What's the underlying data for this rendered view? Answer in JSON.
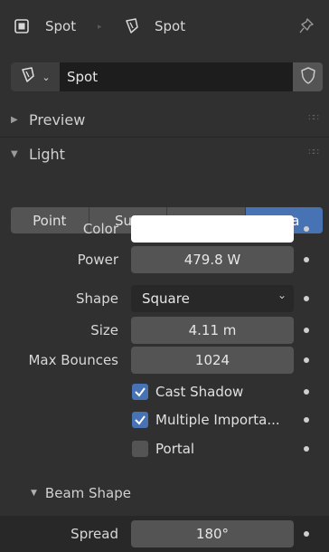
{
  "header": {
    "object_name": "Spot",
    "data_name": "Spot"
  },
  "datablock": {
    "name": "Spot"
  },
  "panels": {
    "preview": "Preview",
    "light": "Light",
    "beam_shape": "Beam Shape"
  },
  "light_types": [
    "Point",
    "Sun",
    "Spot",
    "Area"
  ],
  "selected_type": "Area",
  "props": {
    "color_label": "Color",
    "color_value": "#ffffff",
    "power_label": "Power",
    "power_value": "479.8 W",
    "shape_label": "Shape",
    "shape_value": "Square",
    "size_label": "Size",
    "size_value": "4.11 m",
    "bounces_label": "Max Bounces",
    "bounces_value": "1024",
    "cast_shadow": "Cast Shadow",
    "multiple_importance": "Multiple Importa...",
    "portal": "Portal",
    "spread_label": "Spread",
    "spread_value": "180°"
  },
  "checks": {
    "cast_shadow": true,
    "multiple_importance": true,
    "portal": false
  },
  "colors": {
    "accent": "#4772b3",
    "background": "#303030",
    "field": "#545454"
  }
}
